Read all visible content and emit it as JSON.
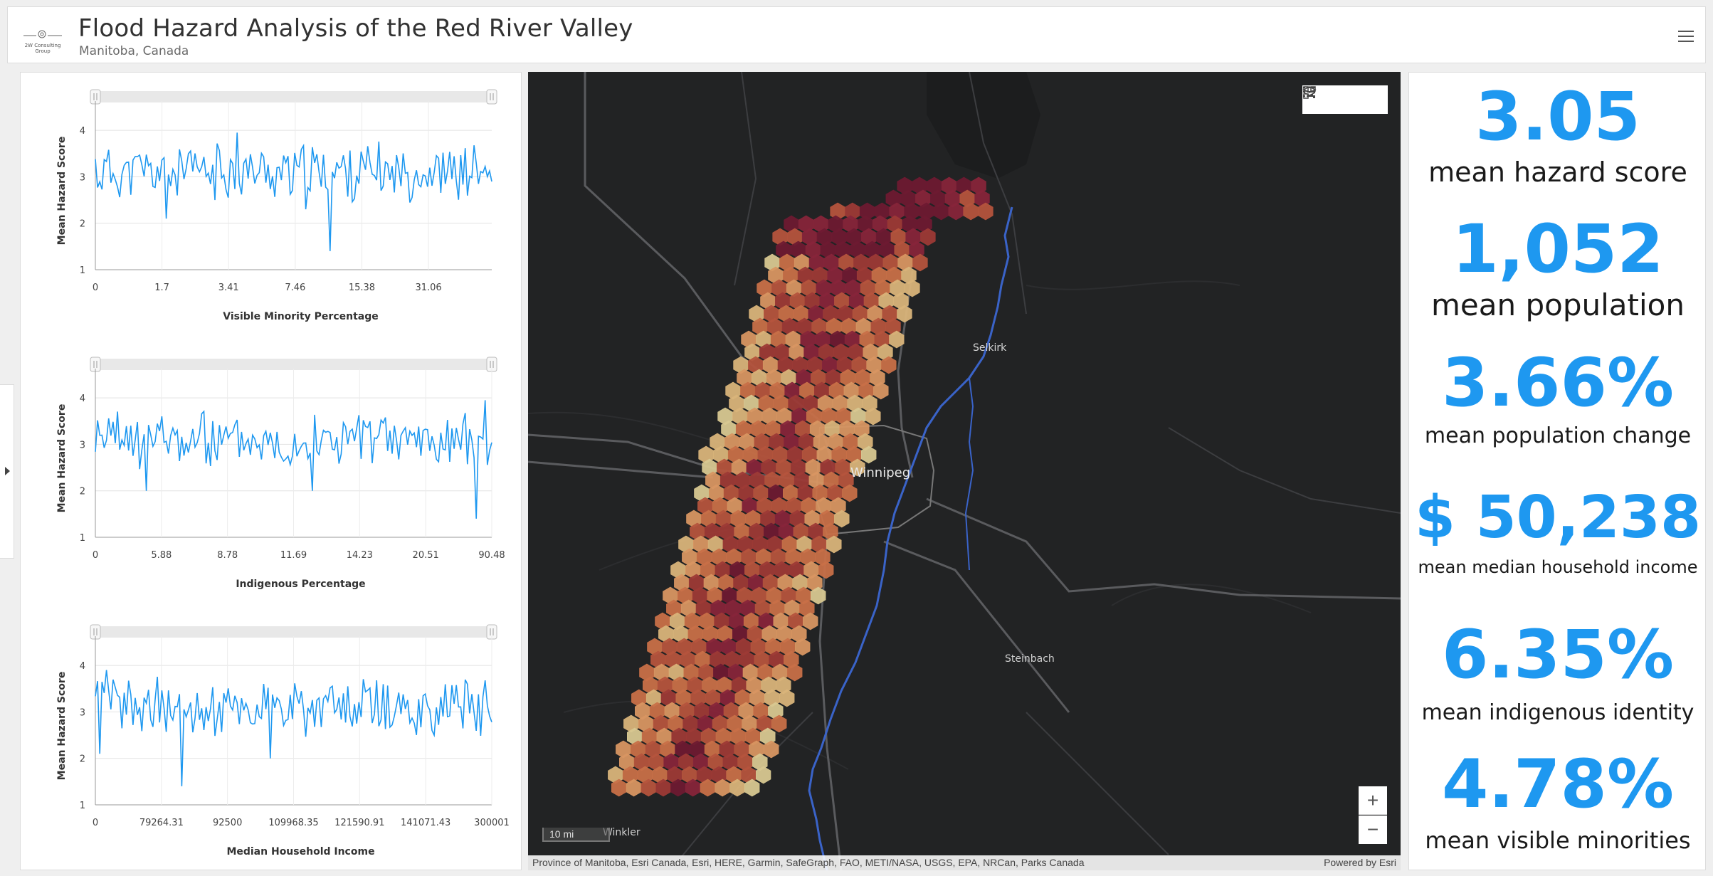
{
  "header": {
    "logo_text": "2W Consulting Group",
    "title": "Flood Hazard Analysis of the Red River Valley",
    "subtitle": "Manitoba, Canada"
  },
  "stats": [
    {
      "value": "3.05",
      "label": "mean hazard score"
    },
    {
      "value": "1,052",
      "label": "mean population"
    },
    {
      "value": "3.66%",
      "label": "mean population change"
    },
    {
      "value": "$ 50,238",
      "label": "mean median household income"
    },
    {
      "value": "6.35%",
      "label": "mean indigenous identity"
    },
    {
      "value": "4.78%",
      "label": "mean visible minorities"
    }
  ],
  "map": {
    "labels": {
      "selkirk": "Selkirk",
      "winnipeg": "Winnipeg",
      "steinbach": "Steinbach",
      "winkler": "Winkler"
    },
    "scale_label": "10 mi",
    "attribution": "Province of Manitoba, Esri Canada, Esri, HERE, Garmin, SafeGraph, FAO, METI/NASA, USGS, EPA, NRCan, Parks Canada",
    "powered_by": "Powered by Esri",
    "zoom_in": "+",
    "zoom_out": "−"
  },
  "chart_data": [
    {
      "type": "line",
      "title": "",
      "xlabel": "Visible Minority Percentage",
      "ylabel": "Mean Hazard Score",
      "x_tick_labels": [
        "0",
        "1.7",
        "3.41",
        "7.46",
        "15.38",
        "31.06"
      ],
      "y_ticks": [
        1,
        2,
        3,
        4
      ],
      "ylim": [
        1,
        4.4
      ],
      "grid": true,
      "seed": 11,
      "mean": 3.1,
      "spikes": [
        [
          0.18,
          2.1
        ],
        [
          0.36,
          3.95
        ],
        [
          0.53,
          2.3
        ],
        [
          0.59,
          1.4
        ]
      ]
    },
    {
      "type": "line",
      "title": "",
      "xlabel": "Indigenous Percentage",
      "ylabel": "Mean Hazard Score",
      "x_tick_labels": [
        "0",
        "5.88",
        "8.78",
        "11.69",
        "14.23",
        "20.51",
        "90.48"
      ],
      "y_ticks": [
        1,
        2,
        3,
        4
      ],
      "ylim": [
        1,
        4.4
      ],
      "grid": true,
      "seed": 23,
      "mean": 3.1,
      "spikes": [
        [
          0.13,
          2.0
        ],
        [
          0.55,
          2.0
        ],
        [
          0.96,
          1.4
        ],
        [
          0.985,
          3.95
        ]
      ]
    },
    {
      "type": "line",
      "title": "",
      "xlabel": "Median Household Income",
      "ylabel": "Mean Hazard Score",
      "x_tick_labels": [
        "0",
        "79264.31",
        "92500",
        "109968.35",
        "121590.91",
        "141071.43",
        "300001"
      ],
      "y_ticks": [
        1,
        2,
        3,
        4
      ],
      "ylim": [
        1,
        4.4
      ],
      "grid": true,
      "seed": 37,
      "mean": 3.1,
      "spikes": [
        [
          0.01,
          2.1
        ],
        [
          0.22,
          1.4
        ],
        [
          0.03,
          3.9
        ],
        [
          0.44,
          2.0
        ]
      ]
    }
  ]
}
